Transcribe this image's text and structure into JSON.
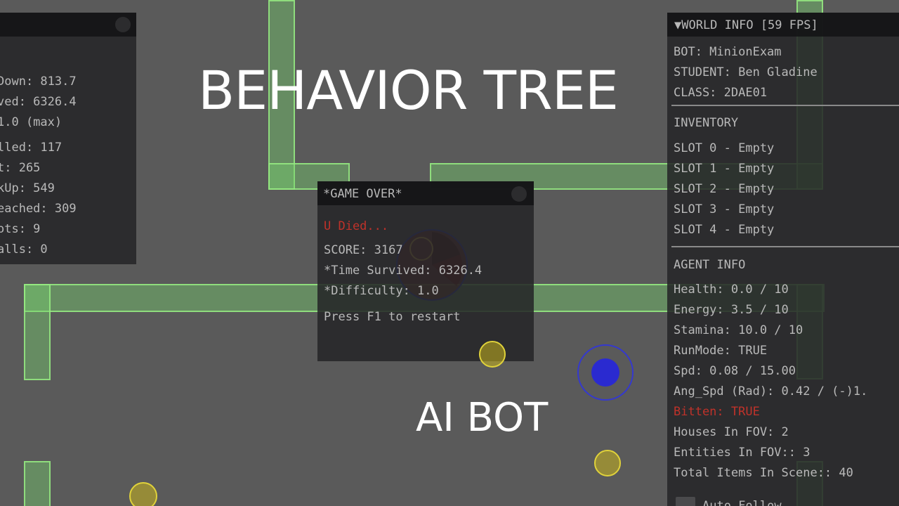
{
  "overlay": {
    "title": "BEHAVIOR TREE",
    "subtitle": "AI BOT"
  },
  "left_panel": {
    "lines": [
      "Down: 813.7",
      "ved: 6326.4",
      " 1.0 (max)",
      "lled: 117",
      "t: 265",
      "kUp: 549",
      "eached: 309",
      "ots: 9",
      "alls: 0"
    ]
  },
  "game_over": {
    "title": "*GAME OVER*",
    "died": "U Died...",
    "score": "SCORE: 3167",
    "time": "*Time Survived: 6326.4",
    "difficulty": "*Difficulty: 1.0",
    "restart": "Press F1 to restart"
  },
  "world_info": {
    "header": "▼WORLD INFO [59 FPS]",
    "bot": "BOT: MinionExam",
    "student": "STUDENT: Ben Gladine",
    "class": "CLASS: 2DAE01",
    "inventory_title": "INVENTORY",
    "slots": [
      "SLOT 0 - Empty",
      "SLOT 1 - Empty",
      "SLOT 2 - Empty",
      "SLOT 3 - Empty",
      "SLOT 4 - Empty"
    ],
    "agent_title": "AGENT INFO",
    "health": "Health: 0.0 / 10",
    "energy": "Energy: 3.5 / 10",
    "stamina": "Stamina: 10.0 / 10",
    "runmode": "RunMode: TRUE",
    "spd": "Spd: 0.08 / 15.00",
    "ang_spd": "Ang_Spd (Rad): 0.42 / (-)1.",
    "bitten": "Bitten: TRUE",
    "houses": "Houses In FOV: 2",
    "entities": "Entities In FOV:: 3",
    "total_items": "Total Items In Scene:: 40",
    "auto_follow": "Auto Follow"
  },
  "colors": {
    "background": "#5a5a5a",
    "wall": "#78d26e",
    "panel": "#242426",
    "text": "#b9b9b9",
    "alert": "#c0322a",
    "agent": "#2a2ad0",
    "item": "#e0d23a"
  }
}
